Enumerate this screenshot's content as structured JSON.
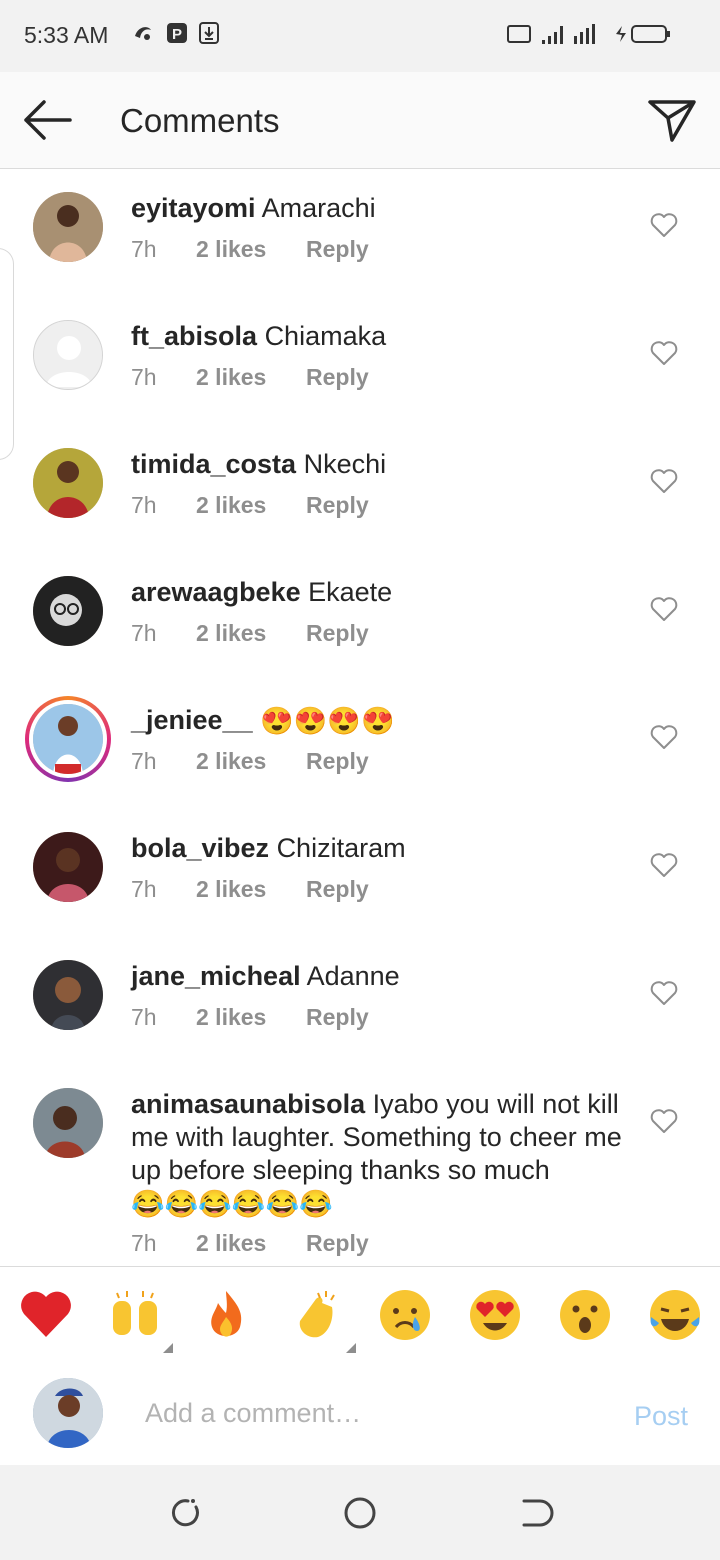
{
  "status_bar": {
    "time": "5:33 AM"
  },
  "header": {
    "title": "Comments"
  },
  "comments": [
    {
      "username": "eyitayomi",
      "text": "Amarachi",
      "emoji": "",
      "time": "7h",
      "likes": "2 likes",
      "reply": "Reply"
    },
    {
      "username": "ft_abisola",
      "text": "Chiamaka",
      "emoji": "",
      "time": "7h",
      "likes": "2 likes",
      "reply": "Reply"
    },
    {
      "username": "timida_costa",
      "text": "Nkechi",
      "emoji": "",
      "time": "7h",
      "likes": "2 likes",
      "reply": "Reply"
    },
    {
      "username": "arewaagbeke",
      "text": "Ekaete",
      "emoji": "",
      "time": "7h",
      "likes": "2 likes",
      "reply": "Reply"
    },
    {
      "username": "_jeniee__",
      "text": "",
      "emoji": "😍😍😍😍",
      "time": "7h",
      "likes": "2 likes",
      "reply": "Reply"
    },
    {
      "username": "bola_vibez",
      "text": "Chizitaram",
      "emoji": "",
      "time": "7h",
      "likes": "2 likes",
      "reply": "Reply"
    },
    {
      "username": "jane_micheal",
      "text": "Adanne",
      "emoji": "",
      "time": "7h",
      "likes": "2 likes",
      "reply": "Reply"
    },
    {
      "username": "animasaunabisola",
      "text": "Iyabo you will not kill me with laughter. Something to cheer me up before sleeping thanks so much",
      "emoji": "😂😂😂😂😂😂",
      "time": "7h",
      "likes": "2 likes",
      "reply": "Reply"
    }
  ],
  "reactions": [
    "❤️",
    "🙌",
    "🔥",
    "👏",
    "😢",
    "😍",
    "😮",
    "😂"
  ],
  "composer": {
    "placeholder": "Add a comment…",
    "post_label": "Post"
  },
  "icons": {
    "back": "arrow-left-icon",
    "send": "paper-plane-icon",
    "heart": "heart-outline-icon",
    "nav": [
      "recents-icon",
      "home-icon",
      "back-icon"
    ]
  }
}
